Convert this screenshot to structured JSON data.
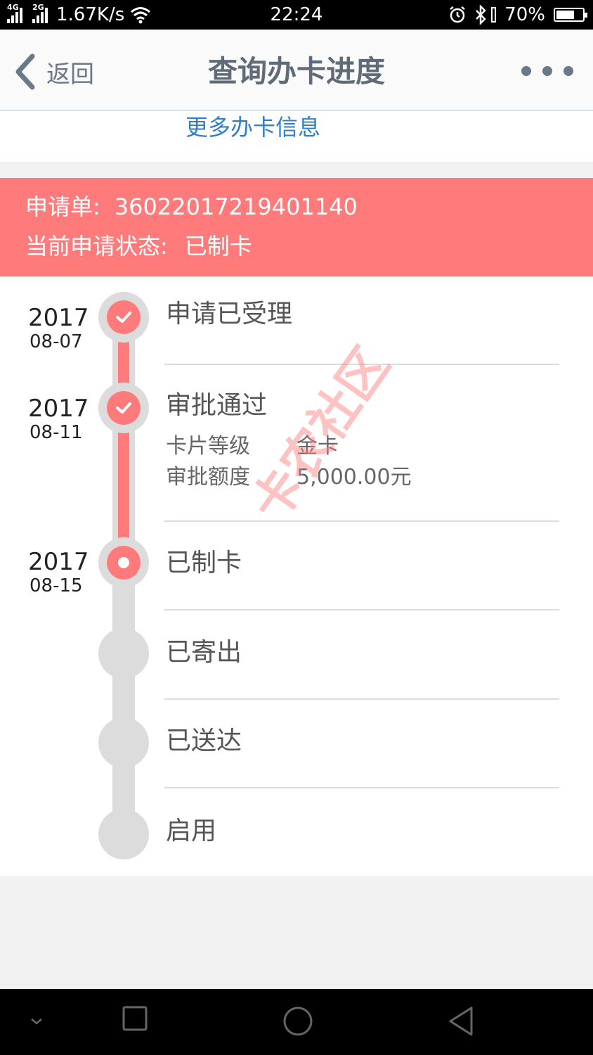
{
  "status_bar": {
    "net_4g": "4G",
    "net_2g": "2G",
    "speed": "1.67K/s",
    "time": "22:24",
    "battery": "70%",
    "battery_level": 0.7
  },
  "nav": {
    "back_label": "返回",
    "title": "查询办卡进度"
  },
  "more_info_link": "更多办卡信息",
  "application": {
    "id_label": "申请单:",
    "id_value": "36022017219401140",
    "status_label": "当前申请状态:",
    "status_value": "已制卡"
  },
  "steps": [
    {
      "title": "申请已受理",
      "year": "2017",
      "date": "08-07",
      "state": "done"
    },
    {
      "title": "审批通过",
      "year": "2017",
      "date": "08-11",
      "state": "done",
      "details": [
        {
          "label": "卡片等级",
          "value": "金卡"
        },
        {
          "label": "审批额度",
          "value": "5,000.00元"
        }
      ]
    },
    {
      "title": "已制卡",
      "year": "2017",
      "date": "08-15",
      "state": "current"
    },
    {
      "title": "已寄出",
      "state": "pending"
    },
    {
      "title": "已送达",
      "state": "pending"
    },
    {
      "title": "启用",
      "state": "pending"
    }
  ],
  "watermark": "卡农社区",
  "colors": {
    "accent": "#ff7b7b",
    "link": "#2e7fc7",
    "rail": "#dcdcdc"
  }
}
